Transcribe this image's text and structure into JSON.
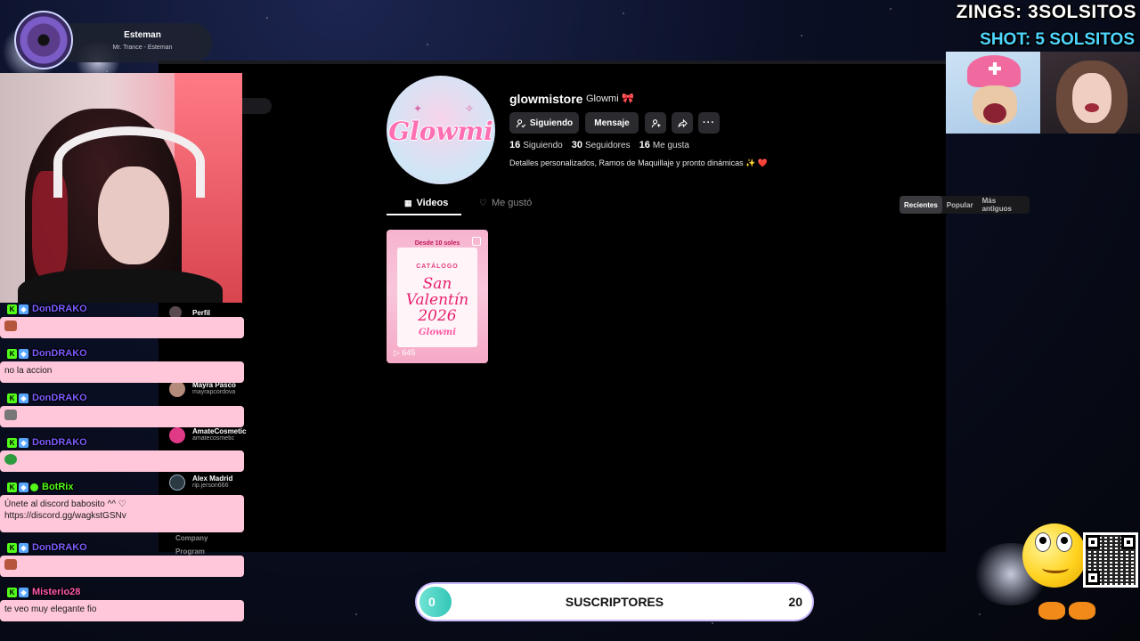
{
  "overlay": {
    "zings": "ZINGS: 3SOLSITOS",
    "shot": "SHOT: 5 SOLSITOS"
  },
  "music": {
    "song": "Esteman",
    "artist": "Mr. Trance - Esteman"
  },
  "profile": {
    "username": "glowmistore",
    "nickname": "Glowmi",
    "avatar_logo": "Glowmi",
    "buttons": {
      "following": "Siguiendo",
      "message": "Mensaje"
    },
    "stats": [
      {
        "value": "16",
        "label": "Siguiendo"
      },
      {
        "value": "30",
        "label": "Seguidores"
      },
      {
        "value": "16",
        "label": "Me gusta"
      }
    ],
    "bio": "Detalles personalizados, Ramos de Maquillaje y pronto dinámicas ✨ ❤️",
    "tabs": {
      "videos": "Videos",
      "liked": "Me gustó"
    },
    "sort": [
      "Recientes",
      "Popular",
      "Más antiguos"
    ],
    "video": {
      "top_label": "Desde 10 soles",
      "catalog": "CATÁLOGO",
      "title_line1": "San",
      "title_line2": "Valentín",
      "title_line3": "2026",
      "brand": "Glowmi",
      "views": "645"
    }
  },
  "sidebar": {
    "profile_label": "Perfil",
    "suggested": [
      {
        "name": "Mayra Pasco",
        "handle": "mayrapcordova"
      },
      {
        "name": "AmateCosmetic",
        "handle": "amatecosmetic"
      },
      {
        "name": "Alex Madrid",
        "handle": "rip.jerson666"
      }
    ],
    "footer": [
      "Company",
      "Program"
    ]
  },
  "chat": [
    {
      "user": "DonDRAKO",
      "color": "#7a5cff",
      "text": ""
    },
    {
      "user": "DonDRAKO",
      "color": "#7a5cff",
      "text": "no la accion"
    },
    {
      "user": "DonDRAKO",
      "color": "#7a5cff",
      "text": ""
    },
    {
      "user": "DonDRAKO",
      "color": "#7a5cff",
      "text": ""
    },
    {
      "user": "BotRix",
      "color": "#53fc18",
      "text_line1": "Únete al discord babosito ^^ ♡",
      "text_line2": "https://discord.gg/wagkstGSNv"
    },
    {
      "user": "DonDRAKO",
      "color": "#7a5cff",
      "text": ""
    },
    {
      "user": "Misterio28",
      "color": "#ff5ab0",
      "text": "te veo muy elegante fio"
    }
  ],
  "subs": {
    "current": "0",
    "label": "SUSCRIPTORES",
    "goal": "20",
    "progress": 0
  }
}
